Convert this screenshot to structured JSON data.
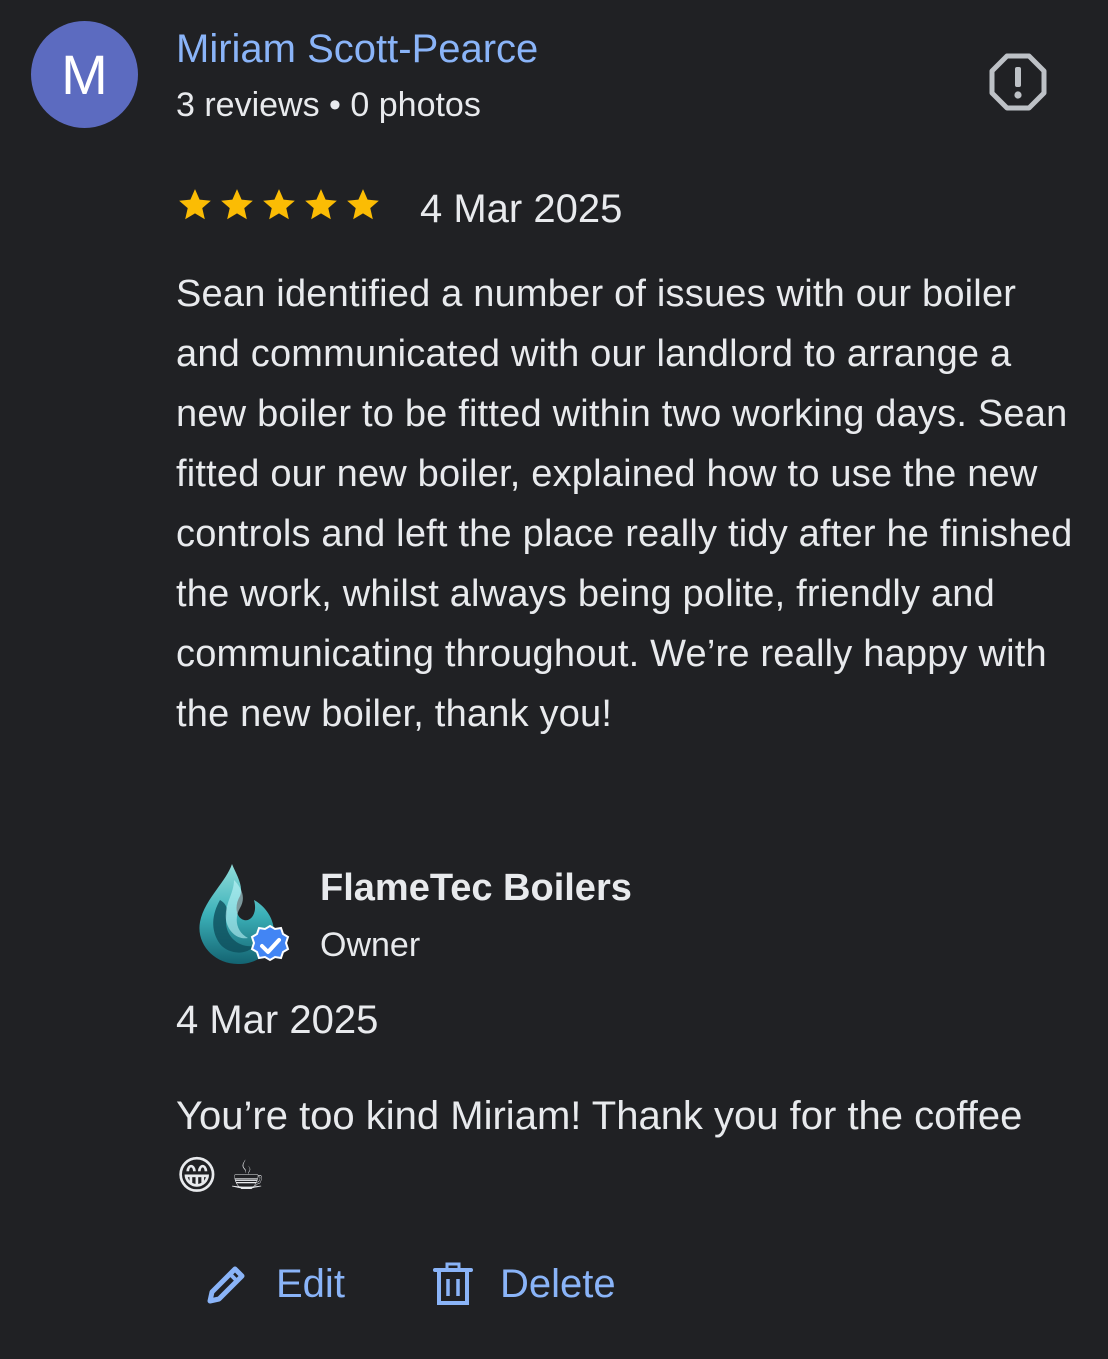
{
  "reviewer": {
    "initial": "M",
    "name": "Miriam Scott-Pearce",
    "meta": "3 reviews • 0 photos",
    "avatar_color": "#5c6bc0"
  },
  "review": {
    "rating": 5,
    "max_rating": 5,
    "star_color": "#fbbc04",
    "date": "4 Mar 2025",
    "text": "Sean identified a number of issues with our boiler and communicated with our landlord to arrange a new boiler to be fitted within two working days. Sean fitted our new boiler, explained how to use the new controls and left the place really tidy after he finished the work, whilst always being polite, friendly and communicating throughout. We’re really happy with the new boiler, thank you!"
  },
  "owner_reply": {
    "business_name": "FlameTec Boilers",
    "role": "Owner",
    "verified_badge_color": "#4285f4",
    "date": "4 Mar 2025",
    "text": "You’re too kind Miriam! Thank you for the coffee😁 ☕"
  },
  "actions": {
    "edit_label": "Edit",
    "delete_label": "Delete",
    "accent_color": "#8ab4f8"
  },
  "icons": {
    "report": "report-flag-icon",
    "edit": "pencil-icon",
    "delete": "trash-icon",
    "star": "star-icon",
    "verified": "verified-badge-icon"
  }
}
